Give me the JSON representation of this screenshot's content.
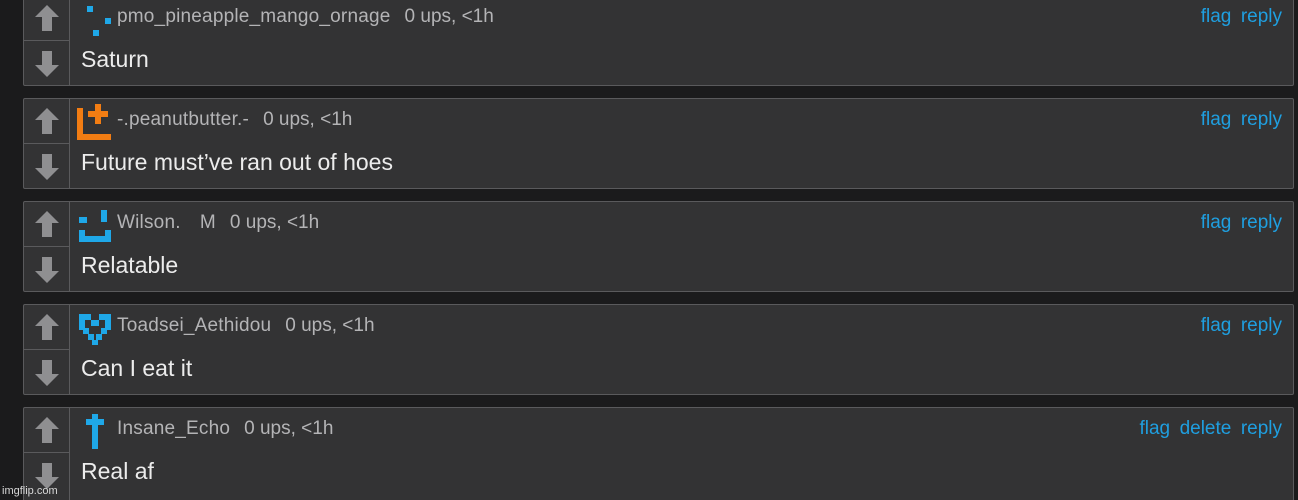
{
  "comments": [
    {
      "username": "pmo_pineapple_mango_ornage",
      "stats": "0 ups, <1h",
      "text": "Saturn",
      "avatar": "pixel-dots-avatar-icon",
      "avatar_color": "#1fa8e8",
      "actions": [
        "flag",
        "reply"
      ]
    },
    {
      "username": "-.peanutbutter.-",
      "stats": "0 ups, <1h",
      "text": "Future must’ve ran out of hoes",
      "avatar": "pixel-plus-avatar-icon",
      "avatar_color": "#f27d13",
      "actions": [
        "flag",
        "reply"
      ]
    },
    {
      "username": "Wilson.　M",
      "stats": "0 ups, <1h",
      "text": "Relatable",
      "avatar": "pixel-face-avatar-icon",
      "avatar_color": "#1fa8e8",
      "actions": [
        "flag",
        "reply"
      ]
    },
    {
      "username": "Toadsei_Aethidou",
      "stats": "0 ups, <1h",
      "text": "Can I eat it",
      "avatar": "pixel-heart-avatar-icon",
      "avatar_color": "#1fa8e8",
      "actions": [
        "flag",
        "reply"
      ]
    },
    {
      "username": "Insane_Echo",
      "stats": "0 ups, <1h",
      "text": "Real af",
      "avatar": "pixel-cross-avatar-icon",
      "avatar_color": "#1fa8e8",
      "actions": [
        "flag",
        "delete",
        "reply"
      ]
    }
  ],
  "icons": {
    "upvote": "arrow-up-icon",
    "downvote": "arrow-down-icon"
  },
  "colors": {
    "background": "#1b1b1c",
    "card": "#333334",
    "border": "#5a5a5c",
    "link": "#1f9fe0",
    "text": "#ececec",
    "muted": "#b4b4b6",
    "arrow": "#8f8f91"
  },
  "watermark": "imgflip.com"
}
